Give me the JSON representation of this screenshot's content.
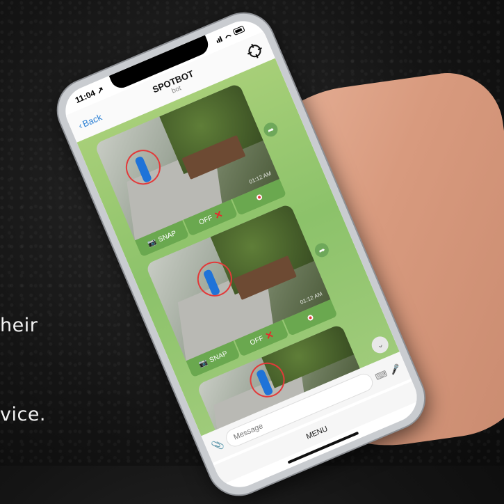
{
  "background_text": [
    "heir",
    "vice."
  ],
  "status": {
    "time": "11:04 ↗"
  },
  "header": {
    "back_label": "Back",
    "title": "SPOTBOT",
    "subtitle": "bot"
  },
  "messages": [
    {
      "snap": "SNAP",
      "off": "OFF",
      "timestamp": "01:12 AM"
    },
    {
      "snap": "SNAP",
      "off": "OFF",
      "timestamp": "01:12 AM"
    },
    {
      "snap": "",
      "off": "",
      "timestamp": ""
    }
  ],
  "input": {
    "placeholder": "Message"
  },
  "menu": {
    "label": "MENU"
  },
  "colors": {
    "chat_bg": "#9fcb7a",
    "button": "#6aa84f",
    "accent_red": "#e23a3a",
    "person": "#1f73d8"
  }
}
